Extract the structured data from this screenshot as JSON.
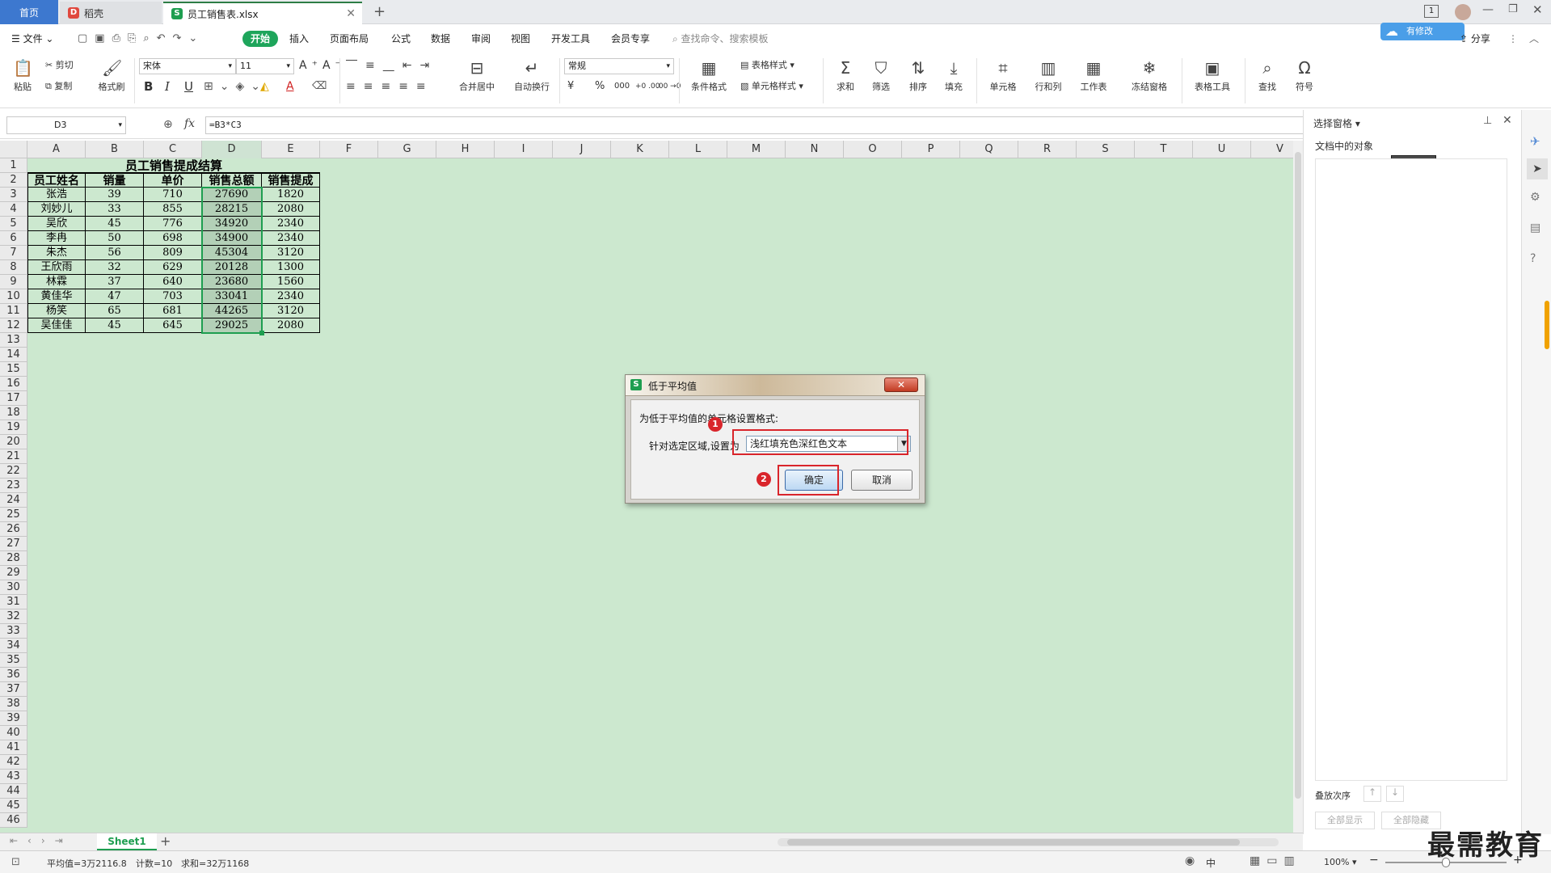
{
  "titlebar": {
    "home_tab": "首页",
    "doc_tab": "稻壳",
    "file_tab": "员工销售表.xlsx",
    "new_tab_icon": "+"
  },
  "menubar": {
    "file": "文件",
    "items": [
      "开始",
      "插入",
      "页面布局",
      "公式",
      "数据",
      "审阅",
      "视图",
      "开发工具",
      "会员专享"
    ],
    "search_placeholder": "查找命令、搜索模板",
    "cloud_badge": "有修改",
    "share": "分享"
  },
  "ribbon": {
    "paste": "粘贴",
    "cut": "剪切",
    "copy": "复制",
    "format_painter": "格式刷",
    "font_name": "宋体",
    "font_size": "11",
    "bold": "B",
    "italic": "I",
    "underline": "U",
    "merge_center": "合并居中",
    "wrap": "自动换行",
    "number_format": "常规",
    "currency": "¥",
    "percent": "%",
    "thousands": "000",
    "inc_dec": "+0 .00",
    "dec_dec": ".00 →0",
    "conditional_format": "条件格式",
    "table_style": "表格样式",
    "cell_style": "单元格样式",
    "sum": "求和",
    "filter": "筛选",
    "sort": "排序",
    "fill": "填充",
    "cell": "单元格",
    "row_col": "行和列",
    "worksheet": "工作表",
    "freeze": "冻结窗格",
    "table_tools": "表格工具",
    "find": "查找",
    "symbol": "符号"
  },
  "formula_bar": {
    "name_box": "D3",
    "fx": "fx",
    "formula": "=B3*C3"
  },
  "grid": {
    "columns": [
      "A",
      "B",
      "C",
      "D",
      "E",
      "F",
      "G",
      "H",
      "I",
      "J",
      "K",
      "L",
      "M",
      "N",
      "O",
      "P",
      "Q",
      "R",
      "S",
      "T",
      "U",
      "V"
    ],
    "title": "员工销售提成结算",
    "headers": [
      "员工姓名",
      "销量",
      "单价",
      "销售总额",
      "销售提成"
    ],
    "rows": [
      [
        "张浩",
        "39",
        "710",
        "27690",
        "1820"
      ],
      [
        "刘妙儿",
        "33",
        "855",
        "28215",
        "2080"
      ],
      [
        "吴欣",
        "45",
        "776",
        "34920",
        "2340"
      ],
      [
        "李冉",
        "50",
        "698",
        "34900",
        "2340"
      ],
      [
        "朱杰",
        "56",
        "809",
        "45304",
        "3120"
      ],
      [
        "王欣雨",
        "32",
        "629",
        "20128",
        "1300"
      ],
      [
        "林霖",
        "37",
        "640",
        "23680",
        "1560"
      ],
      [
        "黄佳华",
        "47",
        "703",
        "33041",
        "2340"
      ],
      [
        "杨笑",
        "65",
        "681",
        "44265",
        "3120"
      ],
      [
        "吴佳佳",
        "45",
        "645",
        "29025",
        "2080"
      ]
    ],
    "row_count": 46
  },
  "right_pane": {
    "title": "选择窗格",
    "objects_label": "文档中的对象",
    "order_label": "叠放次序",
    "show_all": "全部显示",
    "hide_all": "全部隐藏"
  },
  "sheet": {
    "tab": "Sheet1"
  },
  "status": {
    "average": "平均值=3万2116.8",
    "count": "计数=10",
    "sum": "求和=32万1168",
    "zoom": "100%",
    "ime": "中"
  },
  "dialog": {
    "title": "低于平均值",
    "prompt": "为低于平均值的单元格设置格式:",
    "label": "针对选定区域,设置为",
    "selected_option": "浅红填充色深红色文本",
    "ok": "确定",
    "cancel": "取消",
    "badge1": "1",
    "badge2": "2"
  },
  "watermark": "最需教育",
  "colors": {
    "accent_green": "#1ea55b",
    "grid_bg": "#cce8cf",
    "selection": "#b3d0b7",
    "annotation_red": "#d9252b",
    "home_tab_blue": "#3d78cf"
  }
}
